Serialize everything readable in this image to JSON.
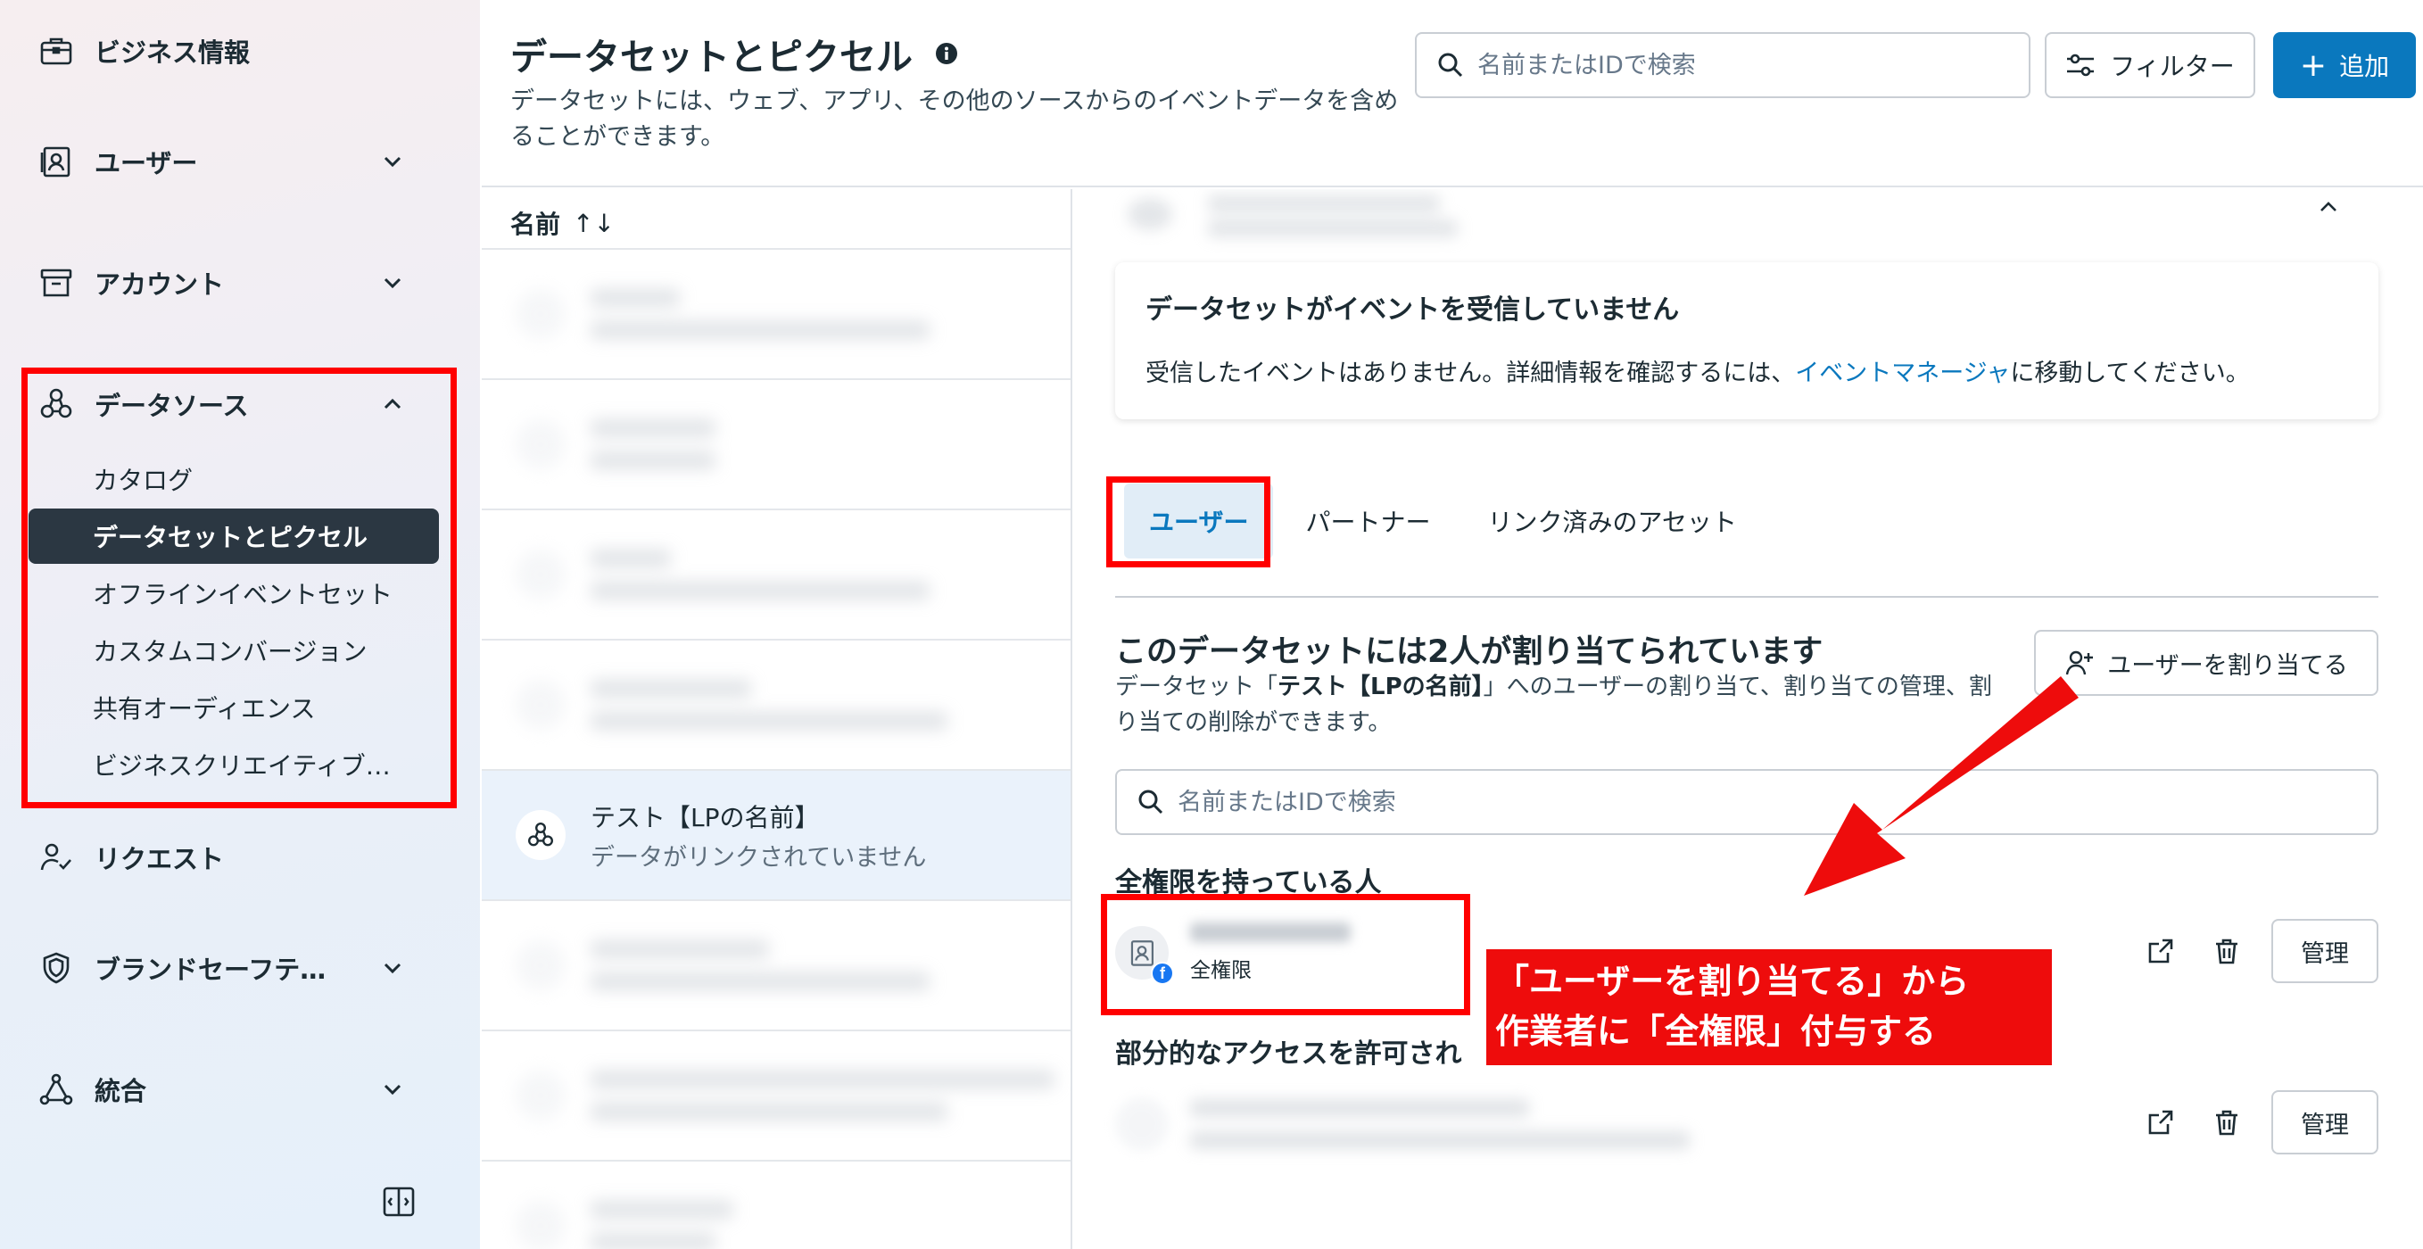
{
  "sidebar": {
    "items": [
      {
        "label": "ビジネス情報",
        "icon": "briefcase-icon"
      },
      {
        "label": "ユーザー",
        "icon": "user-badge-icon"
      },
      {
        "label": "アカウント",
        "icon": "archive-box-icon"
      },
      {
        "label": "データソース",
        "icon": "data-sources-icon"
      },
      {
        "label": "リクエスト",
        "icon": "user-check-icon"
      },
      {
        "label": "ブランドセーフテ…",
        "icon": "shield-icon"
      },
      {
        "label": "統合",
        "icon": "integrations-icon"
      }
    ],
    "data_sources_sub": [
      "カタログ",
      "データセットとピクセル",
      "オフラインイベントセット",
      "カスタムコンバージョン",
      "共有オーディエンス",
      "ビジネスクリエイティブ…"
    ],
    "active_sub_index": 1
  },
  "header": {
    "title": "データセットとピクセル",
    "description": "データセットには、ウェブ、アプリ、その他のソースからのイベントデータを含めることができます。",
    "search_placeholder": "名前またはIDで検索",
    "filter_label": "フィルター",
    "add_label": "追加",
    "add_symbol": "+"
  },
  "list": {
    "column_header": "名前",
    "sort_glyph": "↑↓",
    "selected_item": {
      "title": "テスト【LPの名前】",
      "subtitle": "データがリンクされていません"
    }
  },
  "detail": {
    "notice": {
      "title": "データセットがイベントを受信していません",
      "body_before": "受信したイベントはありません。詳細情報を確認するには、",
      "link": "イベントマネージャ",
      "body_after": "に移動してください。"
    },
    "tabs": [
      "ユーザー",
      "パートナー",
      "リンク済みのアセット"
    ],
    "active_tab": 0,
    "assign": {
      "title": "このデータセットには2人が割り当てられています",
      "desc_before": "データセット「",
      "desc_bold": "テスト【LPの名前】",
      "desc_after": "」へのユーザーの割り当て、割り当ての管理、割り当ての削除ができます。",
      "button_label": "ユーザーを割り当てる"
    },
    "search_placeholder": "名前またはIDで検索",
    "full_access_heading": "全権限を持っている人",
    "full_access_user_role": "全権限",
    "partial_access_heading": "部分的なアクセスを許可され",
    "manage_label": "管理"
  },
  "annotation": {
    "line1": "「ユーザーを割り当てる」から",
    "line2": "作業者に「全権限」付与する",
    "color": "#ee0c0c"
  },
  "colors": {
    "accent": "#0a78be",
    "active_nav_bg": "#2b3742",
    "highlight_red": "#ff0000"
  }
}
